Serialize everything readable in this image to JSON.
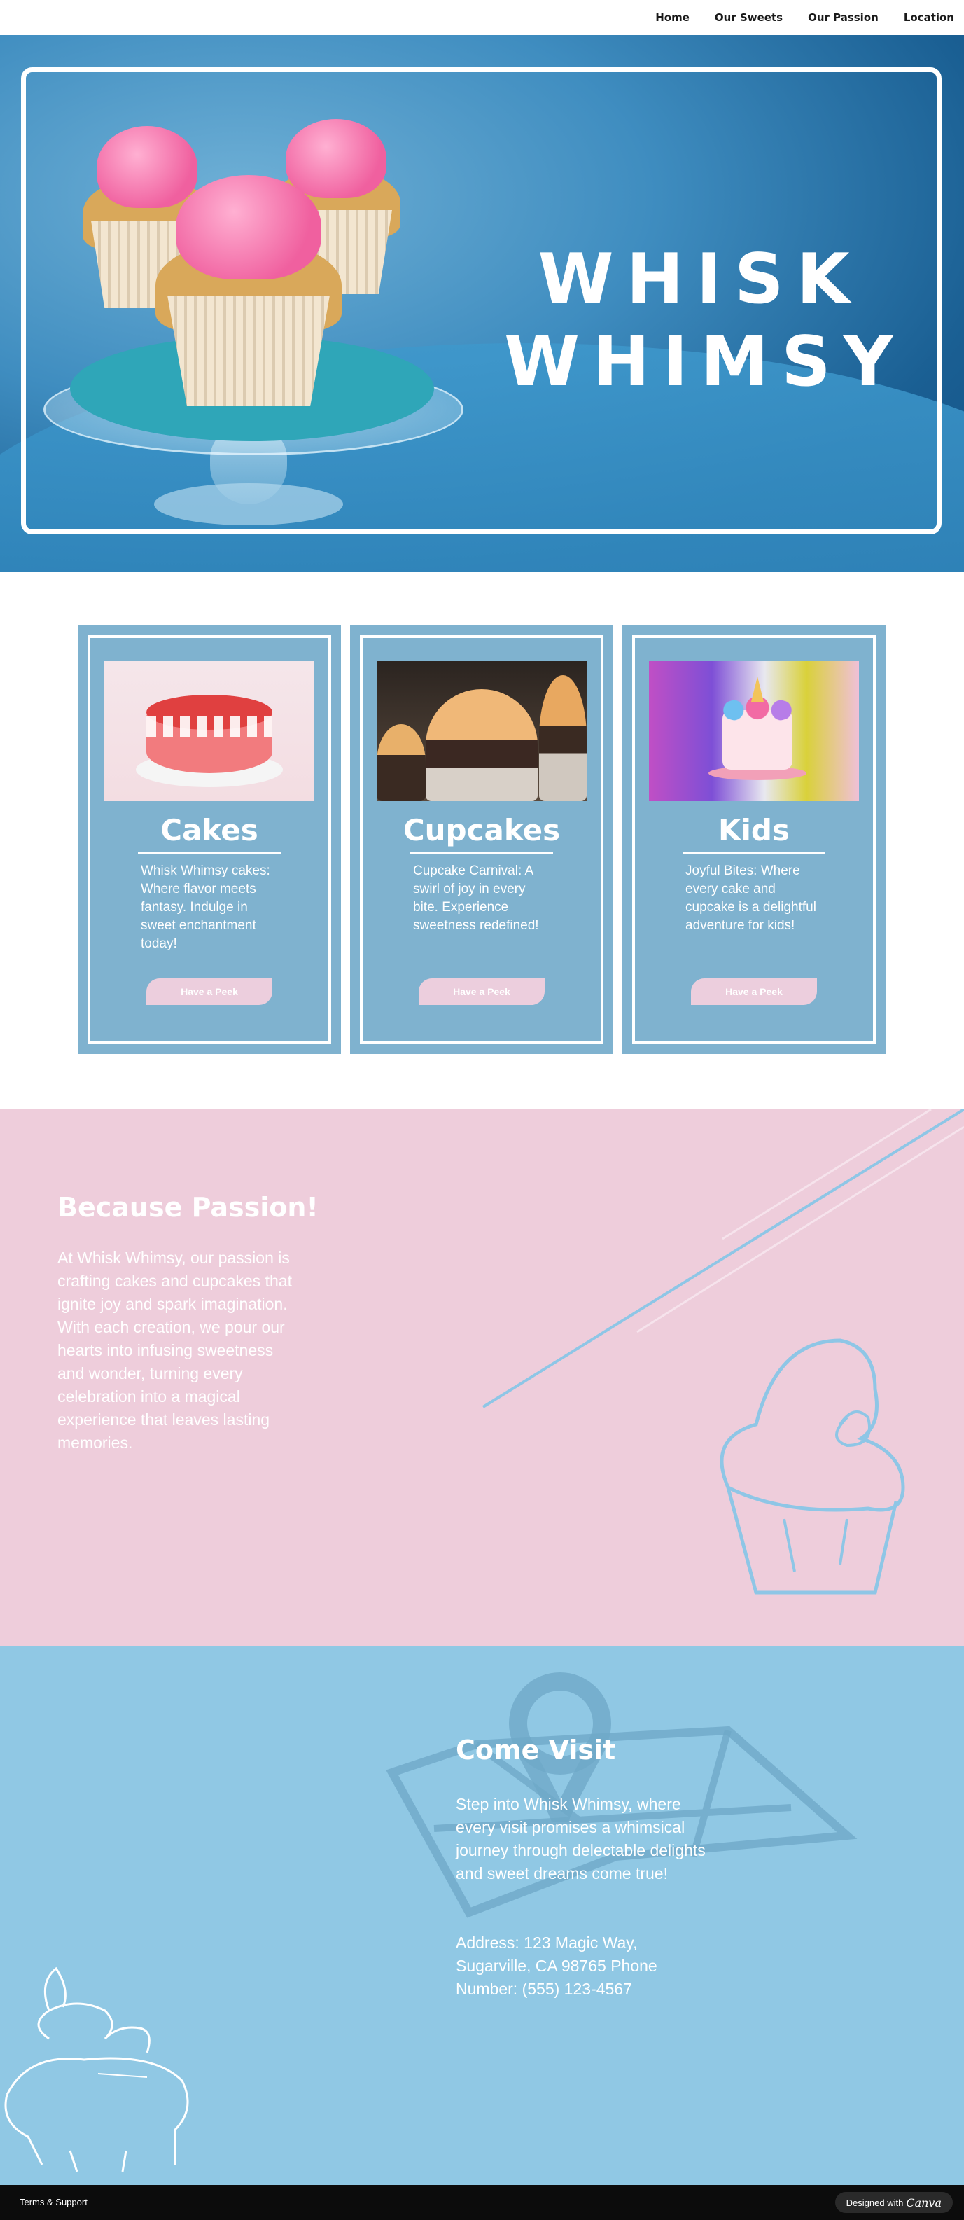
{
  "nav": {
    "items": [
      {
        "label": "Home"
      },
      {
        "label": "Our Sweets"
      },
      {
        "label": "Our Passion"
      },
      {
        "label": "Location"
      }
    ]
  },
  "hero": {
    "title_line1": "WHISK",
    "title_line2": "WHIMSY"
  },
  "cards": [
    {
      "title": "Cakes",
      "description": "Whisk Whimsy cakes: Where flavor meets fantasy. Indulge in sweet enchantment today!",
      "button": "Have a Peek"
    },
    {
      "title": "Cupcakes",
      "description": "Cupcake Carnival: A swirl of joy in every bite. Experience sweetness redefined!",
      "button": "Have a Peek"
    },
    {
      "title": "Kids",
      "description": "Joyful Bites: Where every cake and cupcake is a delightful adventure for kids!",
      "button": "Have a Peek"
    }
  ],
  "passion": {
    "title": "Because Passion!",
    "text": "At Whisk Whimsy, our passion is crafting cakes and cupcakes that ignite joy and spark imagination. With each creation, we pour our hearts into infusing sweetness and wonder, turning every celebration into a magical experience that leaves lasting memories."
  },
  "visit": {
    "title": "Come Visit",
    "text": "Step into Whisk Whimsy, where every visit promises a whimsical journey through delectable delights and sweet dreams come true!",
    "address": "Address: 123 Magic Way, Sugarville, CA 98765 Phone Number: (555) 123-4567"
  },
  "footer": {
    "link": "Terms & Support",
    "badge_prefix": "Designed with",
    "badge_brand": "Canva"
  },
  "colors": {
    "hero_blue": "#1a5f93",
    "card_blue": "#7fb2cf",
    "button_pink": "#eccedd",
    "passion_pink": "#eecddb",
    "visit_blue": "#90c8e4",
    "footer_black": "#0c0c0c"
  }
}
